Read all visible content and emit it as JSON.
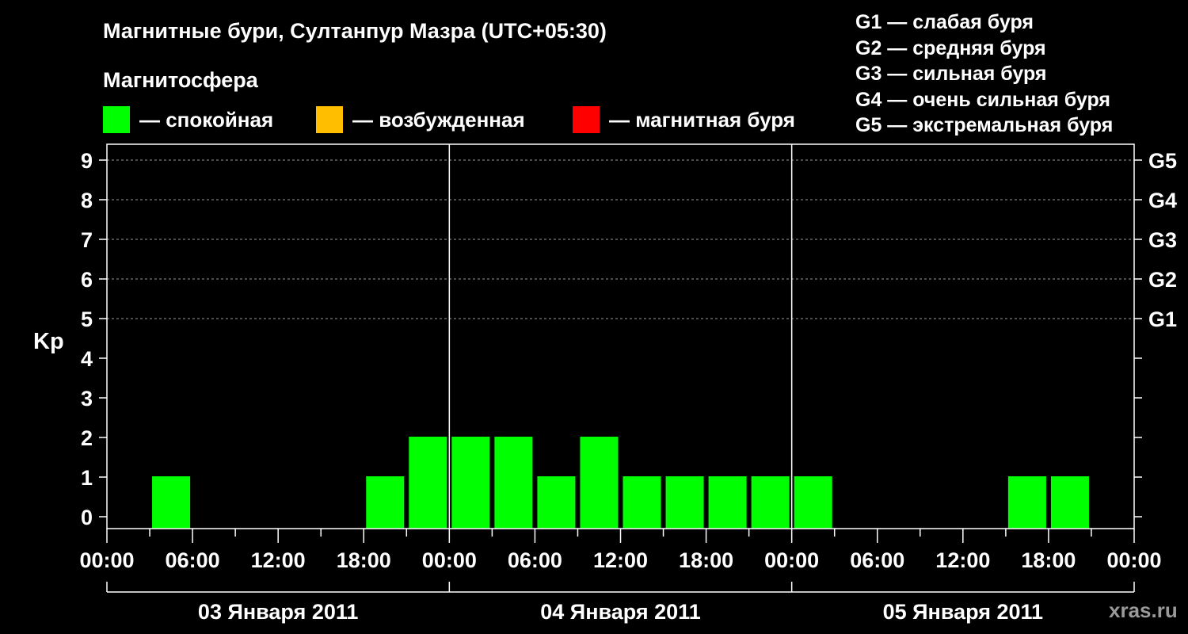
{
  "title": "Магнитные бури, Султанпур Мазра (UTC+05:30)",
  "magnetosphere": {
    "label": "Магнитосфера",
    "items": [
      {
        "color": "#00ff00",
        "text": "— спокойная"
      },
      {
        "color": "#ffbf00",
        "text": "— возбужденная"
      },
      {
        "color": "#ff0000",
        "text": "— магнитная буря"
      }
    ]
  },
  "g_legend": [
    "G1 — слабая буря",
    "G2 — средняя буря",
    "G3 — сильная буря",
    "G4 — очень сильная буря",
    "G5 — экстремальная буря"
  ],
  "brand": "xras.ru",
  "chart_data": {
    "type": "bar",
    "ylabel": "Kp",
    "ylim": [
      0,
      9
    ],
    "y_ticks": [
      0,
      1,
      2,
      3,
      4,
      5,
      6,
      7,
      8,
      9
    ],
    "g_ticks": [
      {
        "kp": 5,
        "label": "G1"
      },
      {
        "kp": 6,
        "label": "G2"
      },
      {
        "kp": 7,
        "label": "G3"
      },
      {
        "kp": 8,
        "label": "G4"
      },
      {
        "kp": 9,
        "label": "G5"
      }
    ],
    "x_range_hours": [
      0,
      72
    ],
    "x_tick_labels": [
      "00:00",
      "06:00",
      "12:00",
      "18:00",
      "00:00",
      "06:00",
      "12:00",
      "18:00",
      "00:00",
      "06:00",
      "12:00",
      "18:00",
      "00:00"
    ],
    "days": [
      "03 Января 2011",
      "04 Января 2011",
      "05 Января 2011"
    ],
    "bar_color": "#00ff00",
    "grid": "dashed at Kp 5–9",
    "bars": [
      {
        "start_hour": 3,
        "kp": 1
      },
      {
        "start_hour": 6,
        "kp": 0
      },
      {
        "start_hour": 9,
        "kp": 0
      },
      {
        "start_hour": 12,
        "kp": 0
      },
      {
        "start_hour": 15,
        "kp": 0
      },
      {
        "start_hour": 18,
        "kp": 1
      },
      {
        "start_hour": 21,
        "kp": 2
      },
      {
        "start_hour": 24,
        "kp": 2
      },
      {
        "start_hour": 27,
        "kp": 2
      },
      {
        "start_hour": 30,
        "kp": 1
      },
      {
        "start_hour": 33,
        "kp": 2
      },
      {
        "start_hour": 36,
        "kp": 1
      },
      {
        "start_hour": 39,
        "kp": 1
      },
      {
        "start_hour": 42,
        "kp": 1
      },
      {
        "start_hour": 45,
        "kp": 1
      },
      {
        "start_hour": 48,
        "kp": 1
      },
      {
        "start_hour": 51,
        "kp": 0
      },
      {
        "start_hour": 54,
        "kp": 0
      },
      {
        "start_hour": 57,
        "kp": 0
      },
      {
        "start_hour": 60,
        "kp": 0
      },
      {
        "start_hour": 63,
        "kp": 1
      },
      {
        "start_hour": 66,
        "kp": 1
      }
    ]
  }
}
